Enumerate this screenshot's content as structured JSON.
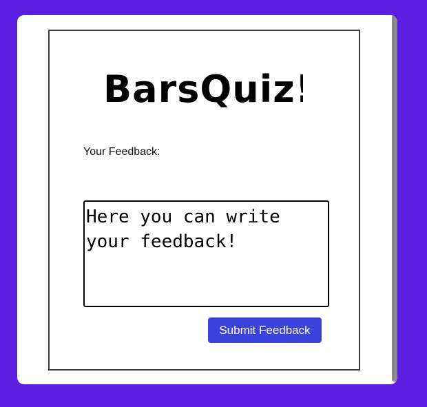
{
  "brand": {
    "logo_text": "BarsQuiz!",
    "background_color": "#5b1ee0"
  },
  "form": {
    "label": "Your Feedback:",
    "placeholder": "Here you can write your feedback!",
    "value": "",
    "submit_label": "Submit Feedback",
    "submit_color": "#3a44dc"
  }
}
